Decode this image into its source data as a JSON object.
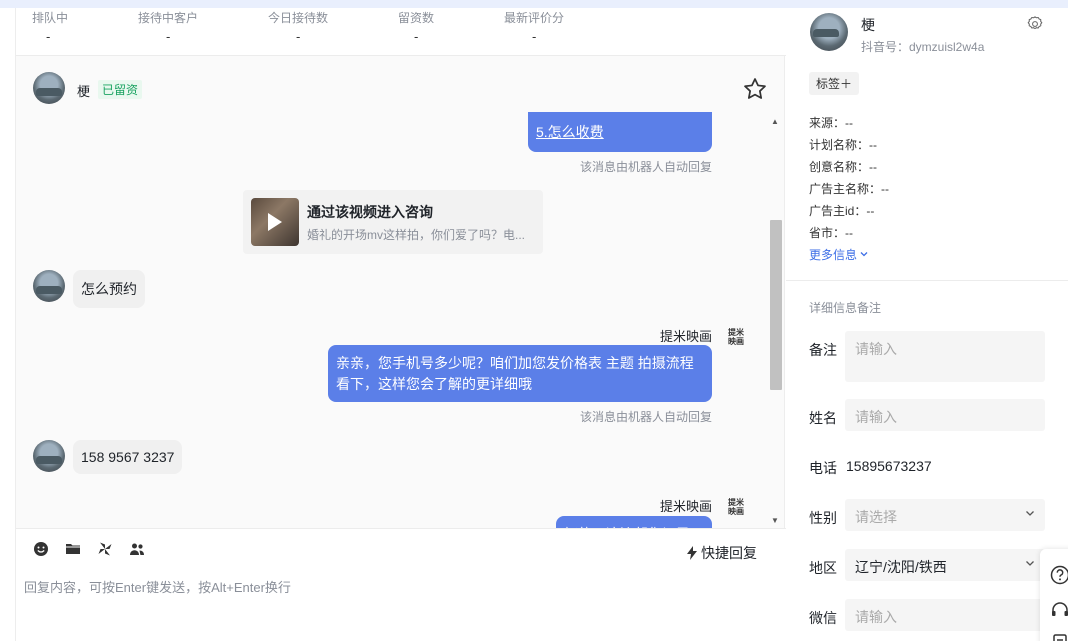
{
  "stats": [
    {
      "label": "排队中",
      "value": "-"
    },
    {
      "label": "接待中客户",
      "value": "-"
    },
    {
      "label": "今日接待数",
      "value": "-"
    },
    {
      "label": "留资数",
      "value": "-"
    },
    {
      "label": "最新评价分",
      "value": "-"
    }
  ],
  "chat_header": {
    "name": "梗",
    "badge": "已留资"
  },
  "messages": {
    "m1": {
      "text": "5.怎么收费",
      "note": "该消息由机器人自动回复"
    },
    "video": {
      "title": "通过该视频进入咨询",
      "desc": "婚礼的开场mv这样拍，你们爱了吗？电..."
    },
    "m2": {
      "text": "怎么预约"
    },
    "m3": {
      "sender": "提米映画",
      "logo": "提米映画",
      "text": "亲亲，您手机号多少呢？咱们加您发价格表 主题 拍摄流程看下，这样您会了解的更详细哦",
      "note": "该消息由机器人自动回复"
    },
    "m4": {
      "text": "158 9567 3237"
    },
    "m5": {
      "sender": "提米映画",
      "logo": "提米映画",
      "text": "好的，这边帮您记录下"
    }
  },
  "composer": {
    "quick_reply": "快捷回复",
    "placeholder": "回复内容，可按Enter键发送，按Alt+Enter换行"
  },
  "profile": {
    "name": "梗",
    "douyin": "抖音号：dymzuisl2w4a",
    "tag_btn": "标签＋",
    "info": [
      {
        "label": "来源：--"
      },
      {
        "label": "计划名称：--"
      },
      {
        "label": "创意名称：--"
      },
      {
        "label": "广告主名称：--"
      },
      {
        "label": "广告主id：--"
      },
      {
        "label": "省市：--"
      }
    ],
    "more_info": "更多信息",
    "section_title": "详细信息备注",
    "fields": {
      "remark": {
        "label": "备注",
        "placeholder": "请输入"
      },
      "name": {
        "label": "姓名",
        "placeholder": "请输入"
      },
      "phone": {
        "label": "电话",
        "value": "15895673237"
      },
      "gender": {
        "label": "性别",
        "placeholder": "请选择"
      },
      "region": {
        "label": "地区",
        "value": "辽宁/沈阳/铁西"
      },
      "wechat": {
        "label": "微信",
        "placeholder": "请输入"
      }
    }
  },
  "colors": {
    "bubble": "#5b7fe8",
    "accent": "#3c6ee6",
    "badge": "#1aa361"
  }
}
